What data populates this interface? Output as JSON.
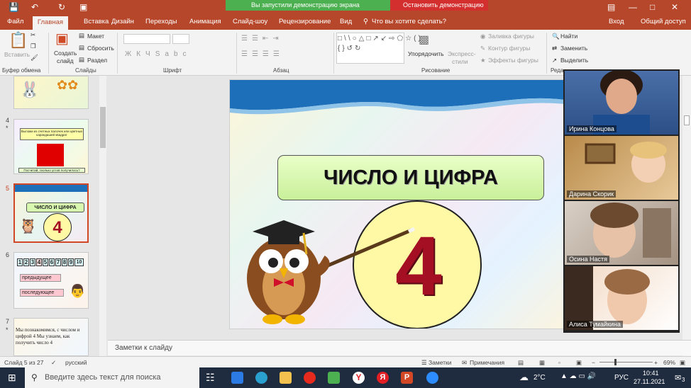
{
  "banners": {
    "sharing": "Вы запустили демонстрацию экрана",
    "stop": "Остановить демонстрацию"
  },
  "tabs": [
    "Файл",
    "Главная",
    "Вставка",
    "Дизайн",
    "Переходы",
    "Анимация",
    "Слайд-шоу",
    "Рецензирование",
    "Вид"
  ],
  "tell_me": "Что вы хотите сделать?",
  "account": {
    "login": "Вход",
    "share": "Общий доступ"
  },
  "ribbon": {
    "paste": "Вставить",
    "create": "Создать",
    "slide": "слайд",
    "layout": "Макет",
    "reset": "Сбросить",
    "section": "Раздел",
    "arrange": "Упорядочить",
    "quick_styles": "Экспресс-",
    "quick_styles2": "стили",
    "fill": "Заливка фигуры",
    "outline": "Контур фигуры",
    "effects": "Эффекты фигуры",
    "find": "Найти",
    "replace": "Заменить",
    "select": "Выделить",
    "groups": {
      "clipboard": "Буфер обмена",
      "slides": "Слайды",
      "font": "Шрифт",
      "paragraph": "Абзац",
      "drawing": "Рисование",
      "editing": "Реда"
    }
  },
  "thumbnails": [
    {
      "num": "4",
      "star": "*",
      "text1": "Выложи из счетных палочек или цветных карандашей квадрат",
      "text2": "Посчитай, сколько углов получилось?"
    },
    {
      "num": "5",
      "title": "ЧИСЛО И ЦИФРА",
      "digit": "4"
    },
    {
      "num": "6",
      "digits": [
        "1",
        "2",
        "3",
        "4",
        "5",
        "6",
        "7",
        "8",
        "9",
        "10"
      ],
      "prev": "предыдущее",
      "next": "последующее"
    },
    {
      "num": "7",
      "star": "*",
      "text": "Мы познакомимся, с числом и цифрой 4 Мы узнаем, как получить число 4"
    }
  ],
  "slide": {
    "title": "ЧИСЛО И ЦИФРА",
    "digit": "4"
  },
  "notes_placeholder": "Заметки к слайду",
  "status": {
    "slide": "Слайд 5 из 27",
    "lang": "русский",
    "notes": "Заметки",
    "comments": "Примечания",
    "zoom": "69%"
  },
  "participants": [
    "Ирина Концова",
    "Дарина Скорик",
    "Осина Настя",
    "Алиса Тумайкина"
  ],
  "taskbar": {
    "search": "Введите здесь текст для поиска",
    "weather": "2°C",
    "lang": "РУС",
    "time": "10:41",
    "date": "27.11.2021",
    "notif": "3"
  }
}
